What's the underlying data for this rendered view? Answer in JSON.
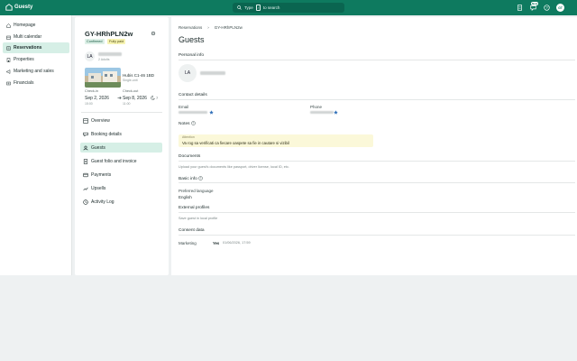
{
  "app": {
    "name": "Guesty",
    "accent": "#0e7a5f"
  },
  "topbar": {
    "search_prefix": "Type",
    "search_key": "/",
    "search_suffix": "to search",
    "badge": "New",
    "user_initials": "GT"
  },
  "leftnav": {
    "items": [
      {
        "label": "Homepage",
        "icon": "home-icon"
      },
      {
        "label": "Multi calendar",
        "icon": "calendar-icon"
      },
      {
        "label": "Reservations",
        "icon": "reservations-icon",
        "active": true
      },
      {
        "label": "Properties",
        "icon": "properties-icon"
      },
      {
        "label": "Marketing and sales",
        "icon": "marketing-icon"
      },
      {
        "label": "Financials",
        "icon": "financials-icon"
      }
    ]
  },
  "reservation": {
    "code": "GY-HRhPLN2w",
    "status": "Confirmed",
    "payment": "Fully paid",
    "guest_initials": "LA",
    "adults": "2 Adults",
    "listing_name": "Hubis C1-46 1BD",
    "listing_sub": "Single-unit",
    "checkin_label": "Check-in",
    "checkin_date": "Sep 2, 2026",
    "checkin_time": "15:00",
    "checkout_label": "Check-out",
    "checkout_date": "Sep 8, 2026",
    "checkout_time": "11:00",
    "nights": "7",
    "menu": [
      {
        "label": "Overview",
        "icon": "overview-icon"
      },
      {
        "label": "Booking details",
        "icon": "booking-icon"
      },
      {
        "label": "Guests",
        "icon": "guests-icon",
        "active": true
      },
      {
        "label": "Guest folio and invoice",
        "icon": "folio-icon"
      },
      {
        "label": "Payments",
        "icon": "payments-icon"
      },
      {
        "label": "Upsells",
        "icon": "upsells-icon"
      },
      {
        "label": "Activity Log",
        "icon": "activity-icon"
      }
    ]
  },
  "main": {
    "breadcrumb_root": "Reservations",
    "breadcrumb_current": "GY-HRhPLN2w",
    "title": "Guests",
    "personal_info": "Personal info",
    "guest_initials": "LA",
    "contact_details": "Contact details",
    "email_label": "Email",
    "phone_label": "Phone",
    "notes_label": "Notes",
    "notes_head": "Attention",
    "notes_text": "Va rog sa verificati ca fiecare oaspete sa fie in cautare si vizibil",
    "documents_label": "Documents",
    "documents_text": "Upload your guest's documents like passport, driver license, local ID, etc.",
    "basic_info": "Basic info",
    "pref_lang_label": "Preferred language",
    "pref_lang_value": "English",
    "external_profiles": "External profiles",
    "external_text": "Save guest in local profile",
    "consent_label": "Consent data",
    "marketing_label": "Marketing",
    "marketing_value": "Yes",
    "marketing_date": "01/06/2026, 17:59"
  }
}
